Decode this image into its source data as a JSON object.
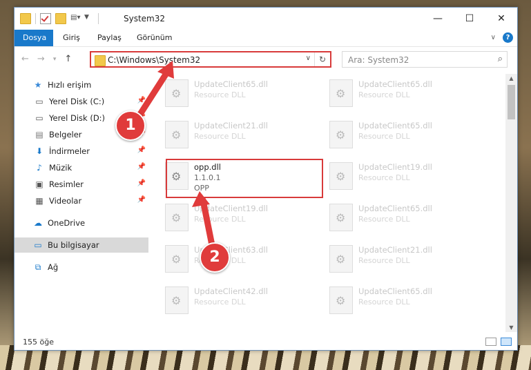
{
  "window": {
    "title": "System32"
  },
  "ribbon": {
    "tabs": [
      "Dosya",
      "Giriş",
      "Paylaş",
      "Görünüm"
    ]
  },
  "address": {
    "path": "C:\\Windows\\System32"
  },
  "search": {
    "placeholder": "Ara: System32"
  },
  "sidebar": {
    "items": [
      {
        "label": "Hızlı erişim",
        "icon": "star-icon"
      },
      {
        "label": "Yerel Disk (C:)",
        "icon": "drive-icon"
      },
      {
        "label": "Yerel Disk (D:)",
        "icon": "drive-icon"
      },
      {
        "label": "Belgeler",
        "icon": "documents-icon"
      },
      {
        "label": "İndirmeler",
        "icon": "download-icon"
      },
      {
        "label": "Müzik",
        "icon": "music-icon"
      },
      {
        "label": "Resimler",
        "icon": "pictures-icon"
      },
      {
        "label": "Videolar",
        "icon": "videos-icon"
      },
      {
        "label": "OneDrive",
        "icon": "cloud-icon"
      },
      {
        "label": "Bu bilgisayar",
        "icon": "computer-icon"
      },
      {
        "label": "Ağ",
        "icon": "network-icon"
      }
    ]
  },
  "files": [
    {
      "name": "UpdateClient65.dll",
      "type": "Resource DLL"
    },
    {
      "name": "UpdateClient65.dll",
      "type": "Resource DLL"
    },
    {
      "name": "UpdateClient21.dll",
      "type": "Resource DLL"
    },
    {
      "name": "UpdateClient65.dll",
      "type": "Resource DLL"
    },
    {
      "name": "opp.dll",
      "version": "1.1.0.1",
      "type": "OPP"
    },
    {
      "name": "UpdateClient19.dll",
      "type": "Resource DLL"
    },
    {
      "name": "UpdateClient19.dll",
      "type": "Resource DLL"
    },
    {
      "name": "UpdateClient65.dll",
      "type": "Resource DLL"
    },
    {
      "name": "UpdateClient63.dll",
      "type": "Resource DLL"
    },
    {
      "name": "UpdateClient21.dll",
      "type": "Resource DLL"
    },
    {
      "name": "UpdateClient42.dll",
      "type": "Resource DLL"
    },
    {
      "name": "UpdateClient65.dll",
      "type": "Resource DLL"
    }
  ],
  "status": {
    "count": "155 öğe"
  },
  "callouts": {
    "one": "1",
    "two": "2"
  },
  "colors": {
    "accent": "#1979ca",
    "highlight": "#d83a3a"
  }
}
